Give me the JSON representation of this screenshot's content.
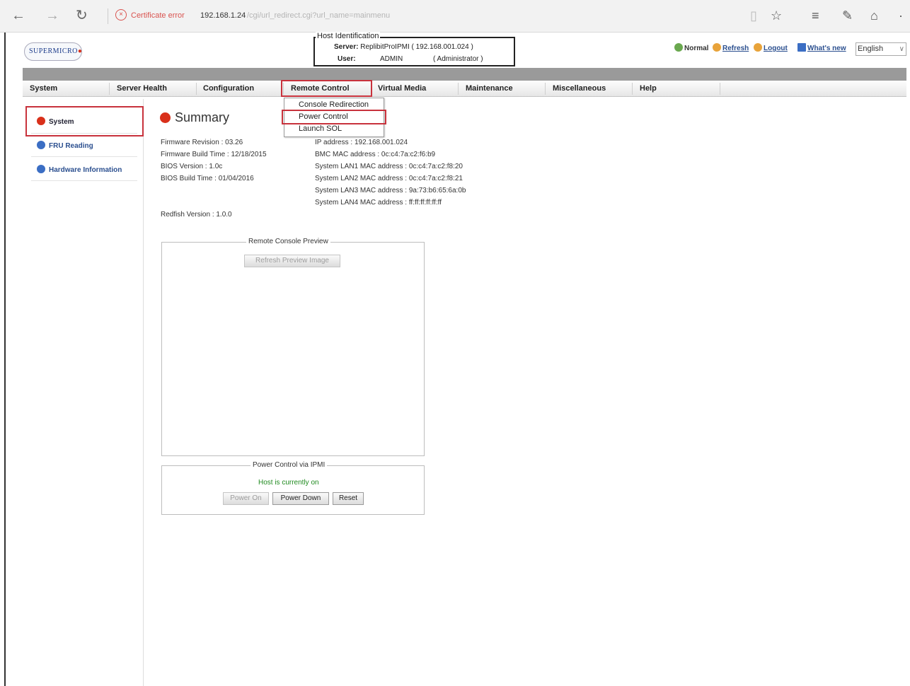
{
  "browser": {
    "back": "←",
    "forward": "→",
    "reload": "↻",
    "cert_error": "Certificate error",
    "url_host": "192.168.1.24",
    "url_path": "/cgi/url_redirect.cgi?url_name=mainmenu",
    "icons": [
      "reading-view-icon",
      "favorite-star-icon",
      "hub-icon",
      "web-note-icon",
      "share-icon",
      "more-icon"
    ]
  },
  "header": {
    "logo": "SUPERMICRO",
    "host_identification": "Host Identification",
    "server_label": "Server:",
    "server_value": "ReplibitProIPMI ( 192.168.001.024 )",
    "user_label": "User:",
    "user_value": "ADMIN",
    "user_role": "( Administrator )",
    "status_normal": "Normal",
    "refresh": "Refresh",
    "logout": "Logout",
    "whats_new": "What's new",
    "language": "English"
  },
  "menu": {
    "items": [
      "System",
      "Server Health",
      "Configuration",
      "Remote Control",
      "Virtual Media",
      "Maintenance",
      "Miscellaneous",
      "Help"
    ],
    "active": "Remote Control",
    "dropdown": [
      "Console Redirection",
      "Power Control",
      "Launch SOL"
    ]
  },
  "leftnav": {
    "items": [
      "System",
      "FRU Reading",
      "Hardware Information"
    ],
    "active": "System"
  },
  "summary": {
    "title": "Summary",
    "firmware_revision": "Firmware Revision : 03.26",
    "firmware_build_time": "Firmware Build Time : 12/18/2015",
    "bios_version": "BIOS Version : 1.0c",
    "bios_build_time": "BIOS Build Time : 01/04/2016",
    "ip_address": "IP address : 192.168.001.024",
    "bmc_mac": "BMC MAC address : 0c:c4:7a:c2:f6:b9",
    "lan1_mac": "System LAN1 MAC address : 0c:c4:7a:c2:f8:20",
    "lan2_mac": "System LAN2 MAC address : 0c:c4:7a:c2:f8:21",
    "lan3_mac": "System LAN3 MAC address : 9a:73:b6:65:6a:0b",
    "lan4_mac": "System LAN4 MAC address : ff:ff:ff:ff:ff:ff",
    "redfish_version": "Redfish Version : 1.0.0"
  },
  "preview": {
    "legend": "Remote Console Preview",
    "refresh_button": "Refresh Preview Image"
  },
  "power": {
    "legend": "Power Control via IPMI",
    "status": "Host is currently on",
    "power_on": "Power On",
    "power_down": "Power Down",
    "reset": "Reset"
  },
  "colors": {
    "highlight_red": "#c8323c",
    "status_green": "#1f8a1f",
    "link_blue": "#2b4f8f"
  }
}
